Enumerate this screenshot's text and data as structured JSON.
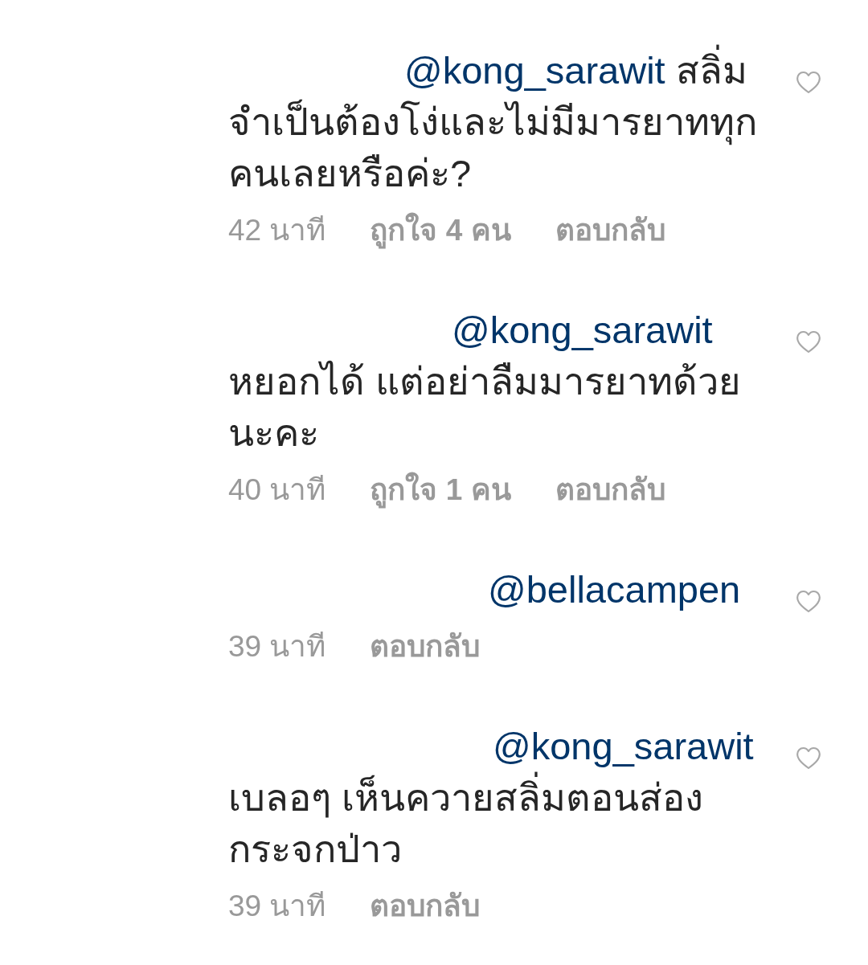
{
  "comments": [
    {
      "mention": "@kong_sarawit",
      "text": "สลิ่มจำเป็นต้องโง่และไม่มีมารยาททุกคนเลยหรือค่ะ?",
      "time": "42 นาที",
      "likes": "ถูกใจ 4 คน",
      "reply": "ตอบกลับ",
      "liked": false
    },
    {
      "mention": "@kong_sarawit",
      "text": "หยอกได้ แต่อย่าลืมมารยาทด้วยนะคะ",
      "time": "40 นาที",
      "likes": "ถูกใจ 1 คน",
      "reply": "ตอบกลับ",
      "liked": false
    },
    {
      "mention": "@bellacampen",
      "time": "39 นาที",
      "reply": "ตอบกลับ",
      "liked": false
    },
    {
      "mention": "@kong_sarawit",
      "text": "เบลอๆ เห็นควายสลิ่มตอนส่องกระจกป่าว",
      "time": "39 นาที",
      "reply": "ตอบกลับ",
      "liked": false
    }
  ]
}
